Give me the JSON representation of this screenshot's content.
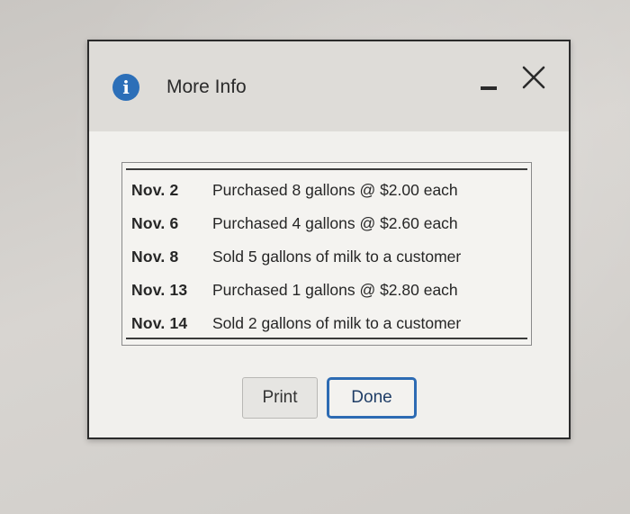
{
  "dialog": {
    "title": "More Info",
    "info_icon_glyph": "i",
    "info_icon": "info-icon",
    "minimize_icon": "minimize-icon",
    "close_icon": "close-icon",
    "accent_color": "#2c6fb8"
  },
  "transactions": [
    {
      "date": "Nov. 2",
      "description": "Purchased 8 gallons @ $2.00 each"
    },
    {
      "date": "Nov. 6",
      "description": "Purchased 4 gallons @ $2.60 each"
    },
    {
      "date": "Nov. 8",
      "description": "Sold 5 gallons of milk to a customer"
    },
    {
      "date": "Nov. 13",
      "description": "Purchased 1 gallons @ $2.80 each"
    },
    {
      "date": "Nov. 14",
      "description": "Sold 2 gallons of milk to a customer"
    }
  ],
  "buttons": {
    "print_label": "Print",
    "done_label": "Done"
  }
}
